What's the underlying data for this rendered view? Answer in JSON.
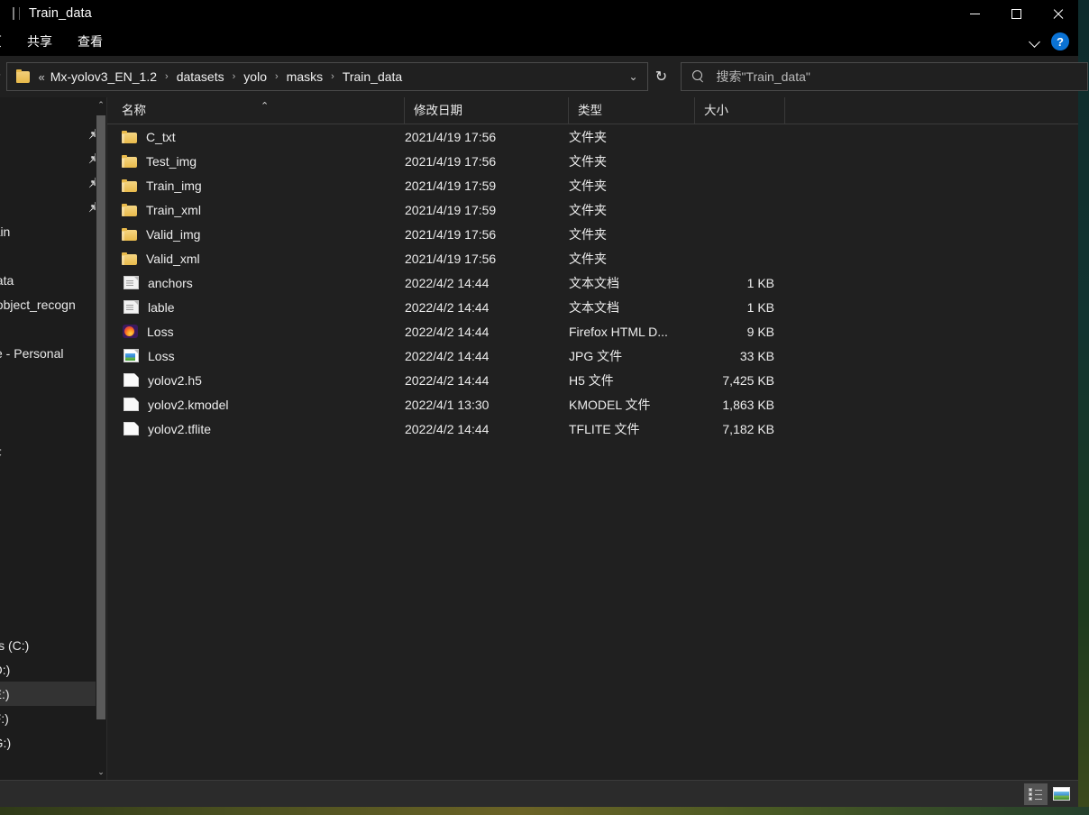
{
  "window": {
    "title": "Train_data",
    "title_icon": "window-icon",
    "controls": {
      "minimize": "minimize-icon",
      "maximize": "maximize-icon",
      "close": "close-icon"
    }
  },
  "ribbon": {
    "tabs": [
      {
        "label": "页",
        "name": "tab-home-clipped"
      },
      {
        "label": "共享",
        "name": "tab-share"
      },
      {
        "label": "查看",
        "name": "tab-view"
      }
    ],
    "expand_icon": "chevron-down-icon",
    "help_label": "?"
  },
  "addressbar": {
    "up_arrow": "↑",
    "folder_icon": "folder-icon",
    "root_sep": "«",
    "crumbs": [
      "Mx-yolov3_EN_1.2",
      "datasets",
      "yolo",
      "masks",
      "Train_data"
    ],
    "separator": "›",
    "dropdown_icon": "⌄",
    "refresh_icon": "↻"
  },
  "search": {
    "icon": "search-icon",
    "placeholder": "搜索\"Train_data\"",
    "value": ""
  },
  "sidebar": {
    "scroll_up_icon": "⌃",
    "scroll_down_icon": "⌄",
    "items": [
      {
        "label": "]",
        "pinned": false,
        "selected": false
      },
      {
        "label": "",
        "pinned": true,
        "selected": false
      },
      {
        "label": "",
        "pinned": true,
        "selected": false
      },
      {
        "label": "",
        "pinned": true,
        "selected": false
      },
      {
        "label": "",
        "pinned": true,
        "selected": false
      },
      {
        "label": "rain",
        "pinned": false,
        "selected": false
      },
      {
        "label": "",
        "pinned": false,
        "selected": false
      },
      {
        "label": "data",
        "pinned": false,
        "selected": false
      },
      {
        "label": "_object_recogn",
        "pinned": false,
        "selected": false
      },
      {
        "label": "",
        "pinned": false,
        "selected": false
      },
      {
        "label": "ve - Personal",
        "pinned": false,
        "selected": false
      },
      {
        "label": "",
        "pinned": false,
        "selected": false
      },
      {
        "label": "",
        "pinned": false,
        "selected": false
      },
      {
        "label": "",
        "pinned": false,
        "selected": false
      },
      {
        "label": "录",
        "pinned": false,
        "selected": false
      },
      {
        "label": "",
        "pinned": false,
        "selected": false
      },
      {
        "label": "",
        "pinned": false,
        "selected": false
      },
      {
        "label": "",
        "pinned": false,
        "selected": false
      },
      {
        "label": "",
        "pinned": false,
        "selected": false
      },
      {
        "label": "",
        "pinned": false,
        "selected": false
      },
      {
        "label": "",
        "pinned": false,
        "selected": false
      },
      {
        "label": "",
        "pinned": false,
        "selected": false
      },
      {
        "label": "ws (C:)",
        "pinned": false,
        "selected": false
      },
      {
        "label": "(D:)",
        "pinned": false,
        "selected": false
      },
      {
        "label": "(E:)",
        "pinned": false,
        "selected": true
      },
      {
        "label": "(F:)",
        "pinned": false,
        "selected": false
      },
      {
        "label": "(G:)",
        "pinned": false,
        "selected": false
      }
    ]
  },
  "columns": {
    "name": "名称",
    "date": "修改日期",
    "type": "类型",
    "size": "大小",
    "sort_indicator": "⌃"
  },
  "files": [
    {
      "name": "C_txt",
      "date": "2021/4/19 17:56",
      "type": "文件夹",
      "size": "",
      "icon": "folder"
    },
    {
      "name": "Test_img",
      "date": "2021/4/19 17:56",
      "type": "文件夹",
      "size": "",
      "icon": "folder"
    },
    {
      "name": "Train_img",
      "date": "2021/4/19 17:59",
      "type": "文件夹",
      "size": "",
      "icon": "folder"
    },
    {
      "name": "Train_xml",
      "date": "2021/4/19 17:59",
      "type": "文件夹",
      "size": "",
      "icon": "folder"
    },
    {
      "name": "Valid_img",
      "date": "2021/4/19 17:56",
      "type": "文件夹",
      "size": "",
      "icon": "folder"
    },
    {
      "name": "Valid_xml",
      "date": "2021/4/19 17:56",
      "type": "文件夹",
      "size": "",
      "icon": "folder"
    },
    {
      "name": "anchors",
      "date": "2022/4/2 14:44",
      "type": "文本文档",
      "size": "1 KB",
      "icon": "text"
    },
    {
      "name": "lable",
      "date": "2022/4/2 14:44",
      "type": "文本文档",
      "size": "1 KB",
      "icon": "text"
    },
    {
      "name": "Loss",
      "date": "2022/4/2 14:44",
      "type": "Firefox HTML D...",
      "size": "9 KB",
      "icon": "firefox"
    },
    {
      "name": "Loss",
      "date": "2022/4/2 14:44",
      "type": "JPG 文件",
      "size": "33 KB",
      "icon": "image"
    },
    {
      "name": "yolov2.h5",
      "date": "2022/4/2 14:44",
      "type": "H5 文件",
      "size": "7,425 KB",
      "icon": "blank"
    },
    {
      "name": "yolov2.kmodel",
      "date": "2022/4/1 13:30",
      "type": "KMODEL 文件",
      "size": "1,863 KB",
      "icon": "blank"
    },
    {
      "name": "yolov2.tflite",
      "date": "2022/4/2 14:44",
      "type": "TFLITE 文件",
      "size": "7,182 KB",
      "icon": "blank"
    }
  ],
  "statusbar": {
    "details_view": "details-view-icon",
    "large_icons_view": "large-icons-view-icon"
  }
}
